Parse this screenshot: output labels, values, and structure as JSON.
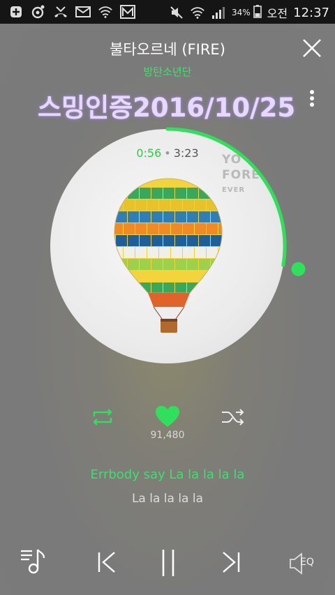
{
  "status_bar": {
    "icons_left": [
      "plus-box-icon",
      "record-icon",
      "missed-call-icon",
      "mail-icon",
      "wifi-call-icon",
      "gallery-icon"
    ],
    "icons_right": [
      "mute-icon",
      "wifi-icon",
      "signal-icon",
      "battery-icon"
    ],
    "battery_percent": "34%",
    "time_period": "오전",
    "time": "12:37"
  },
  "header": {
    "song_title": "불타오르네 (FIRE)",
    "artist": "방탄소년단",
    "overlay_text": "스밍인증2016/10/25"
  },
  "player": {
    "current_time": "0:56",
    "separator": "•",
    "total_time": "3:23",
    "progress": 0.2759,
    "album_text_line1": "YO",
    "album_text_line2": "FORE",
    "album_text_line3": "EVER"
  },
  "actions": {
    "like_count": "91,480"
  },
  "lyrics": {
    "current": "Errbody say La la la la la",
    "next": "La la la la la"
  },
  "bottom": {
    "eq_label": "EQ"
  },
  "colors": {
    "accent": "#2ee05a",
    "overlay_text": "#e7d8ff"
  }
}
